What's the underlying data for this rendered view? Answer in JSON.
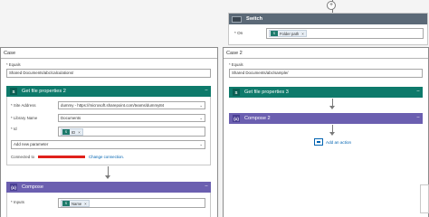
{
  "switch": {
    "title": "Switch",
    "on_label": "* On",
    "on_token": {
      "icon": "sharepoint-token-icon",
      "icon_text": "S",
      "label": "Folder path",
      "remove": "×"
    }
  },
  "case_left": {
    "title": "Case",
    "equals_label": "* Equals",
    "equals_value": "Shared Documents/abc/calculations/",
    "get_file": {
      "title": "Get file properties 2",
      "more": "···",
      "fields": [
        {
          "label": "* Site Address",
          "value": "dummy - https://microsoft.sharepoint.com/teams/dummy84",
          "type": "dropdown"
        },
        {
          "label": "* Library Name",
          "value": "Documents",
          "type": "dropdown"
        },
        {
          "label": "* Id",
          "type": "token"
        }
      ],
      "id_token": {
        "icon_text": "S",
        "label": "ID",
        "remove": "×"
      },
      "add_parameter": "Add new parameter",
      "connected_to": "Connected to",
      "change_connection": "Change connection."
    },
    "compose": {
      "title": "Compose",
      "more": "···",
      "inputs_label": "* Inputs",
      "token": {
        "icon_text": "S",
        "label": "Name",
        "remove": "×"
      }
    }
  },
  "case_right": {
    "title": "Case 2",
    "equals_label": "* Equals",
    "equals_value": "Shared Documents/abc/sample/",
    "get_file": {
      "title": "Get file properties 3",
      "more": "···"
    },
    "compose": {
      "title": "Compose 2",
      "more": "···"
    },
    "add_action": "Add an action"
  },
  "top_connector": {
    "plus": "+"
  },
  "colors": {
    "sharepoint_header": "#0e7a6b",
    "compose_header": "#6b5fb0",
    "switch_header": "#5b6977",
    "link": "#0063b1",
    "redaction": "#e0211b"
  }
}
